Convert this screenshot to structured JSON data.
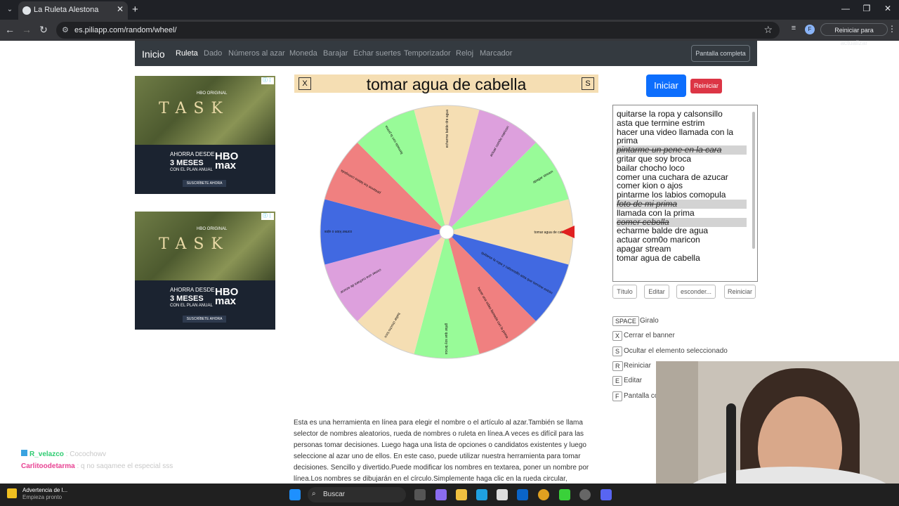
{
  "browser": {
    "tab_title": "La Ruleta Alestona",
    "url": "es.piliapp.com/random/wheel/",
    "profile_initial": "F",
    "reload_label": "Reiniciar para actualizar"
  },
  "site_nav": {
    "brand": "Inicio",
    "links": [
      "Ruleta",
      "Dado",
      "Números al azar",
      "Moneda",
      "Barajar",
      "Echar suertes",
      "Temporizador",
      "Reloj",
      "Marcador"
    ],
    "fullscreen": "Pantalla completa"
  },
  "ad": {
    "brand_small": "HBO ORIGINAL",
    "title": "TASK",
    "line1": "AHORRA DESDE",
    "line2": "3 MESES",
    "line3": "CON EL PLAN ANUAL",
    "logo": "HBO max",
    "cta": "SUSCRÍBETE AHORA"
  },
  "banner": {
    "close_key": "X",
    "hide_key": "S",
    "result": "tomar agua de cabella"
  },
  "buttons": {
    "start": "Iniciar",
    "reset_top": "Reiniciar"
  },
  "options": [
    {
      "text": "quitarse la ropa y calsonsillo",
      "hidden": false
    },
    {
      "text": "asta que termine estrim",
      "hidden": false
    },
    {
      "text": "hacer una video llamada con la",
      "hidden": false
    },
    {
      "text": "prima",
      "hidden": false
    },
    {
      "text": "pintarme un pene en la cara",
      "hidden": true
    },
    {
      "text": "gritar que soy broca",
      "hidden": false
    },
    {
      "text": "bailar chocho loco",
      "hidden": false
    },
    {
      "text": "comer una cuchara de azucar",
      "hidden": false
    },
    {
      "text": "comer kion o ajos",
      "hidden": false
    },
    {
      "text": "pintarme los labios comopula",
      "hidden": false
    },
    {
      "text": "foto de mi prima",
      "hidden": true
    },
    {
      "text": "llamada con la prima",
      "hidden": false
    },
    {
      "text": "comer cebolla",
      "hidden": true
    },
    {
      "text": "echarme balde dre agua",
      "hidden": false
    },
    {
      "text": "actuar com0o maricon",
      "hidden": false
    },
    {
      "text": "apagar stream",
      "hidden": false
    },
    {
      "text": "tomar agua de cabella",
      "hidden": false
    }
  ],
  "controls": [
    "Título",
    "Editar",
    "esconder...",
    "Reiniciar"
  ],
  "shortcuts": [
    {
      "key": "SPACE",
      "desc": "Giralo"
    },
    {
      "key": "X",
      "desc": "Cerrar el banner"
    },
    {
      "key": "S",
      "desc": "Ocultar el elemento seleccionado"
    },
    {
      "key": "R",
      "desc": "Reiniciar"
    },
    {
      "key": "E",
      "desc": "Editar"
    },
    {
      "key": "F",
      "desc": "Pantalla co"
    }
  ],
  "description": "Esta es una herramienta en línea para elegir el nombre o el artículo al azar.También se llama selector de nombres aleatorios, rueda de nombres o ruleta en línea.A veces es difícil para las personas tomar decisiones. Luego haga una lista de opciones o candidatos existentes y luego seleccione al azar uno de ellos. En este caso, puede utilizar nuestra herramienta para tomar decisiones. Sencillo y divertido.Puede modificar los nombres en textarea, poner un nombre por línea.Los nombres se dibujarán en el círculo.Simplemente haga clic en la rueda circular,",
  "wheel": {
    "segments": [
      {
        "label": "tomar agua de cabella",
        "color": "#f5deb3"
      },
      {
        "label": "quitarse la ropa y calsonsillo asta que termine estrim",
        "color": "#4169e1"
      },
      {
        "label": "hacer una video llamada con la prima",
        "color": "#f08080"
      },
      {
        "label": "gritar que soy broca",
        "color": "#98fb98"
      },
      {
        "label": "bailar chocho loco",
        "color": "#f5deb3"
      },
      {
        "label": "comer una cuchara de azucar",
        "color": "#dda0dd"
      },
      {
        "label": "comer kion o ajos",
        "color": "#4169e1"
      },
      {
        "label": "pintarme los labios comopula",
        "color": "#f08080"
      },
      {
        "label": "llamada con la prima",
        "color": "#98fb98"
      },
      {
        "label": "echarme balde dre agua",
        "color": "#f5deb3"
      },
      {
        "label": "actuar com0o maricon",
        "color": "#dda0dd"
      },
      {
        "label": "apagar stream",
        "color": "#98fb98"
      }
    ],
    "pointer_color": "#e02020"
  },
  "chat": [
    {
      "user": "R_velazco",
      "message": "Cocochowv"
    },
    {
      "user": "Carlitoodetarma",
      "message": "q no saqamee el especial sss"
    }
  ],
  "taskbar": {
    "notice_title": "Advertencia de l...",
    "notice_sub": "Empieza pronto",
    "search": "Buscar"
  }
}
